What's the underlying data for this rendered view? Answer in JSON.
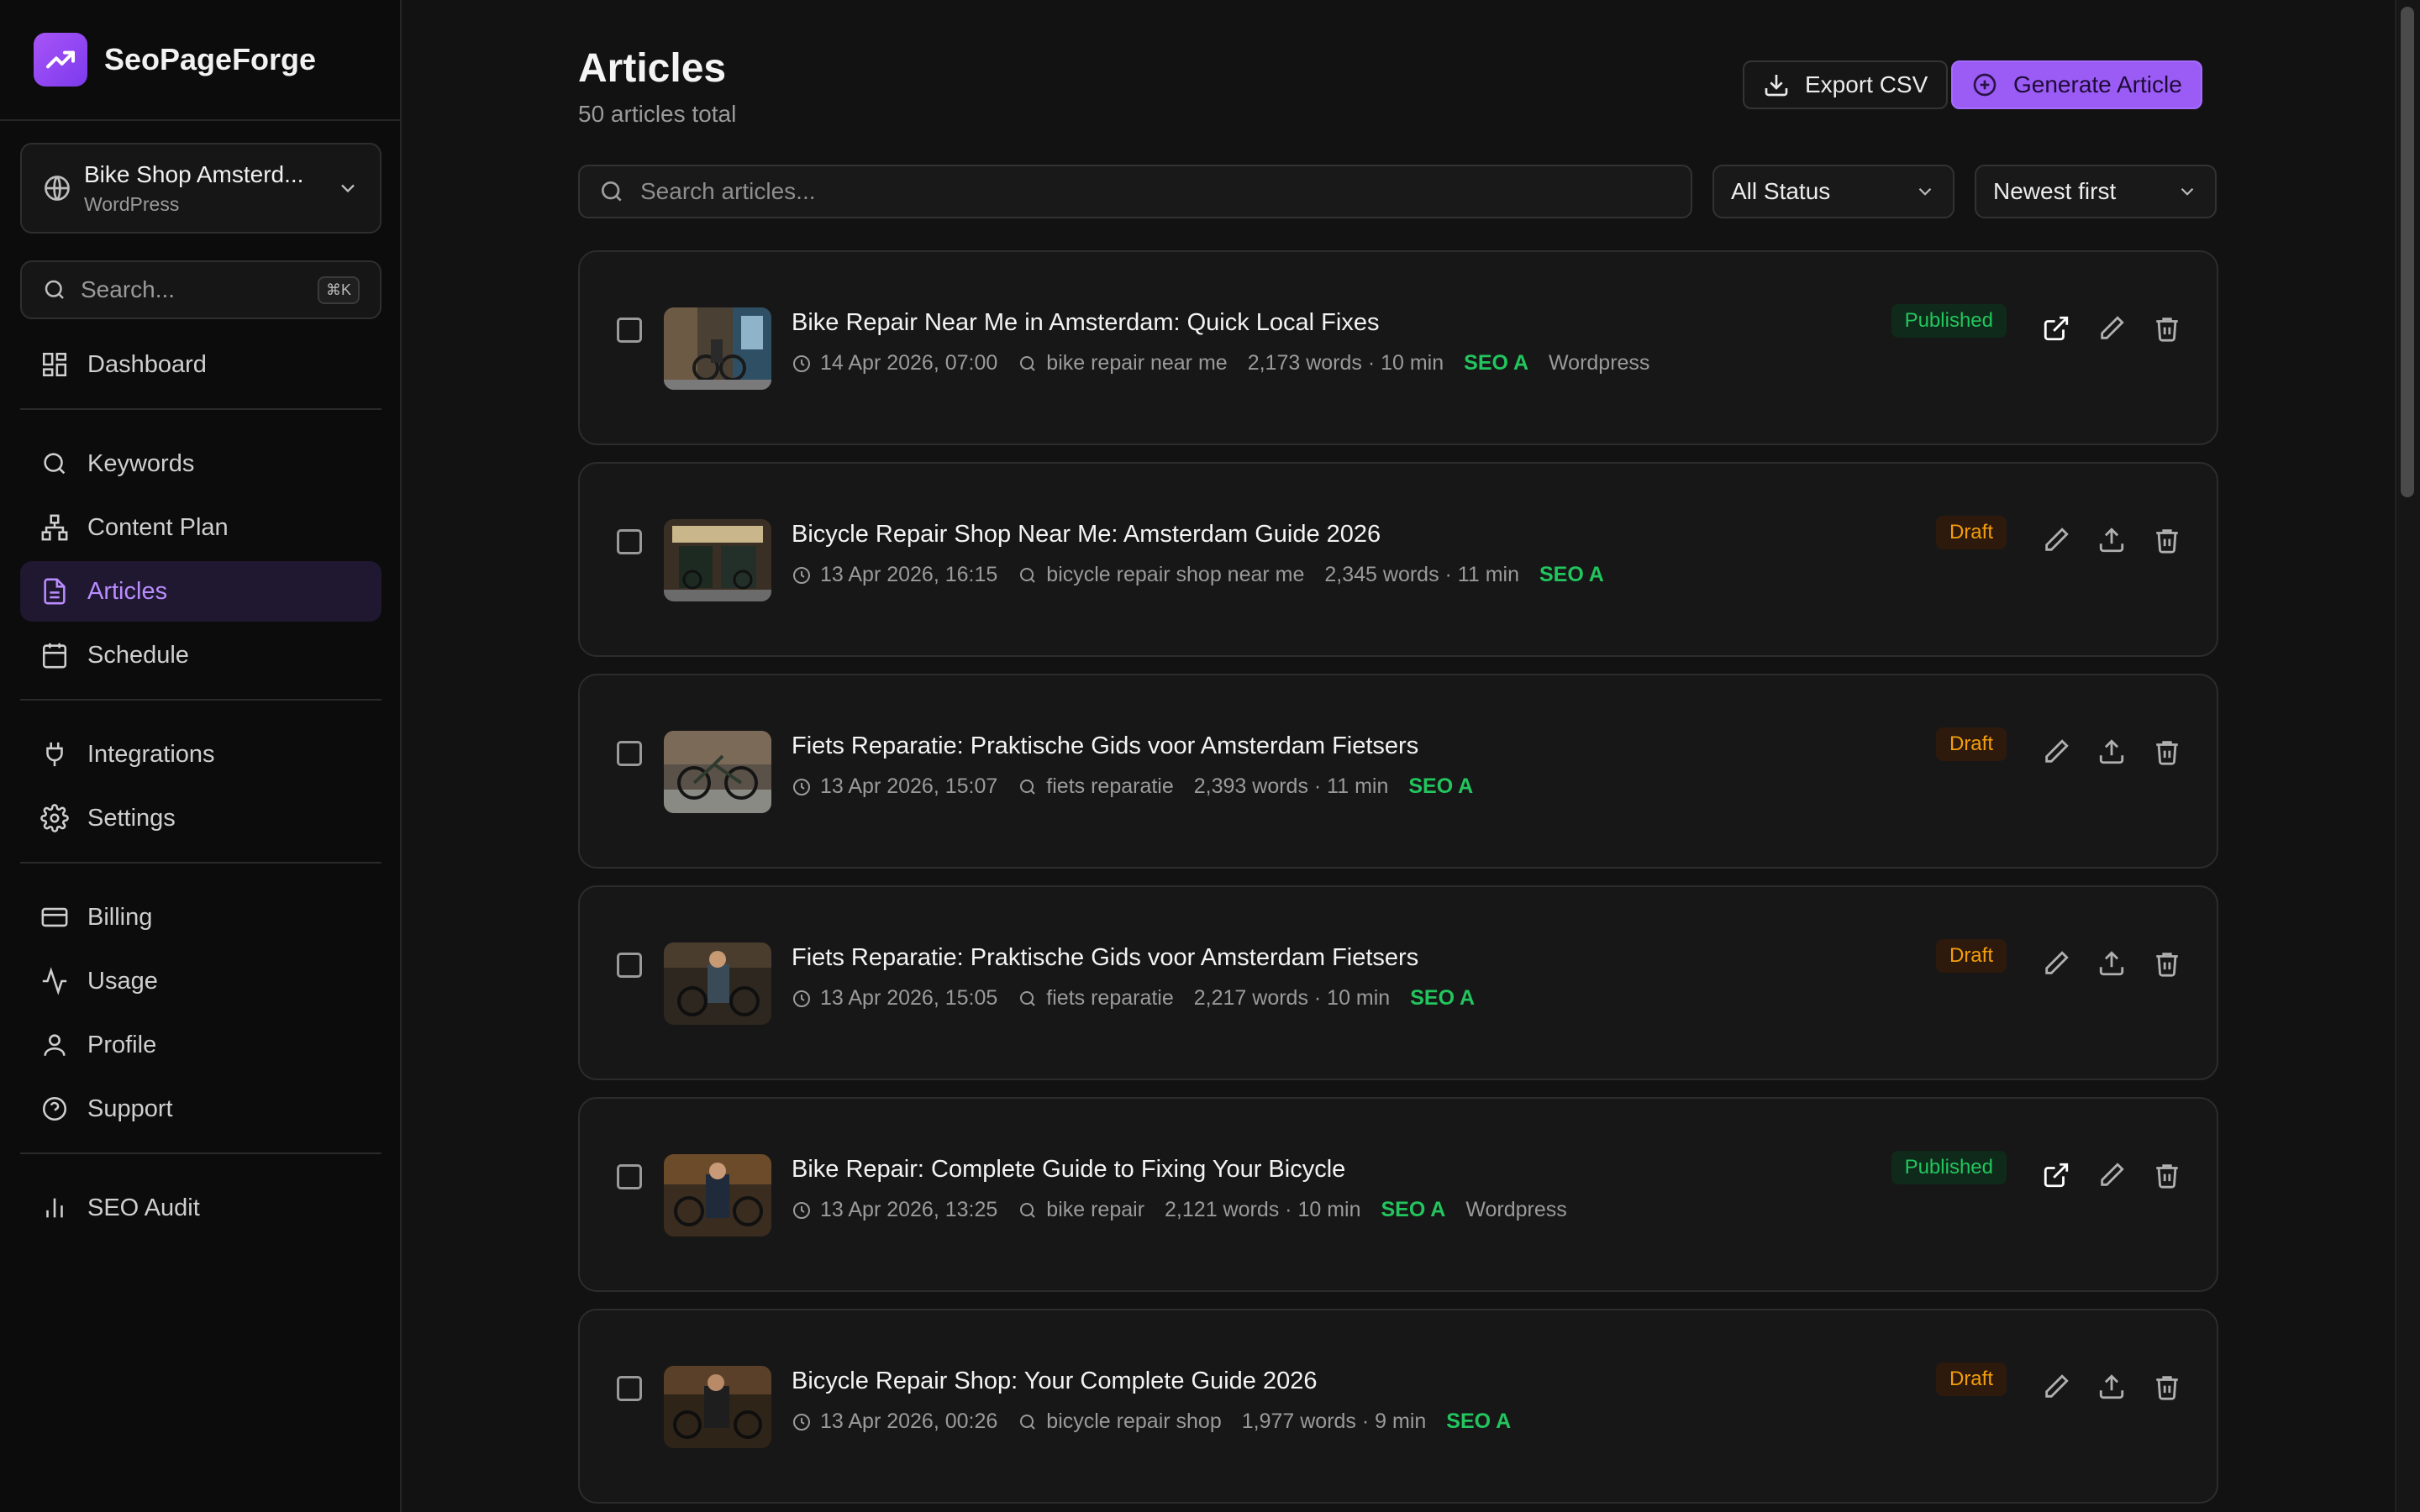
{
  "app": {
    "name": "SeoPageForge"
  },
  "site": {
    "name": "Bike Shop Amsterd...",
    "platform": "WordPress"
  },
  "sidebar": {
    "search_placeholder": "Search...",
    "search_shortcut": "⌘K",
    "groups": [
      [
        {
          "label": "Dashboard",
          "icon": "dashboard-icon"
        }
      ],
      [
        {
          "label": "Keywords",
          "icon": "search-icon"
        },
        {
          "label": "Content Plan",
          "icon": "sitemap-icon"
        },
        {
          "label": "Articles",
          "icon": "document-icon",
          "active": true
        },
        {
          "label": "Schedule",
          "icon": "calendar-icon"
        }
      ],
      [
        {
          "label": "Integrations",
          "icon": "plug-icon"
        },
        {
          "label": "Settings",
          "icon": "gear-icon"
        }
      ],
      [
        {
          "label": "Billing",
          "icon": "credit-card-icon"
        },
        {
          "label": "Usage",
          "icon": "activity-icon"
        },
        {
          "label": "Profile",
          "icon": "user-icon"
        },
        {
          "label": "Support",
          "icon": "help-circle-icon"
        }
      ],
      [
        {
          "label": "SEO Audit",
          "icon": "bar-chart-icon"
        }
      ]
    ]
  },
  "header": {
    "title": "Articles",
    "subtitle": "50 articles total",
    "export_label": "Export CSV",
    "generate_label": "Generate Article"
  },
  "filters": {
    "search_placeholder": "Search articles...",
    "status": "All Status",
    "sort": "Newest first"
  },
  "articles": [
    {
      "title": "Bike Repair Near Me in Amsterdam: Quick Local Fixes",
      "date": "14 Apr 2026, 07:00",
      "keyword": "bike repair near me",
      "stats": "2,173 words · 10 min",
      "seo": "SEO A",
      "platform": "Wordpress",
      "status": "Published"
    },
    {
      "title": "Bicycle Repair Shop Near Me: Amsterdam Guide 2026",
      "date": "13 Apr 2026, 16:15",
      "keyword": "bicycle repair shop near me",
      "stats": "2,345 words · 11 min",
      "seo": "SEO A",
      "platform": "",
      "status": "Draft"
    },
    {
      "title": "Fiets Reparatie: Praktische Gids voor Amsterdam Fietsers",
      "date": "13 Apr 2026, 15:07",
      "keyword": "fiets reparatie",
      "stats": "2,393 words · 11 min",
      "seo": "SEO A",
      "platform": "",
      "status": "Draft"
    },
    {
      "title": "Fiets Reparatie: Praktische Gids voor Amsterdam Fietsers",
      "date": "13 Apr 2026, 15:05",
      "keyword": "fiets reparatie",
      "stats": "2,217 words · 10 min",
      "seo": "SEO A",
      "platform": "",
      "status": "Draft"
    },
    {
      "title": "Bike Repair: Complete Guide to Fixing Your Bicycle",
      "date": "13 Apr 2026, 13:25",
      "keyword": "bike repair",
      "stats": "2,121 words · 10 min",
      "seo": "SEO A",
      "platform": "Wordpress",
      "status": "Published"
    },
    {
      "title": "Bicycle Repair Shop: Your Complete Guide 2026",
      "date": "13 Apr 2026, 00:26",
      "keyword": "bicycle repair shop",
      "stats": "1,977 words · 9 min",
      "seo": "SEO A",
      "platform": "",
      "status": "Draft"
    }
  ],
  "colors": {
    "accent": "#9b5cf6",
    "published": "#22c55e",
    "draft": "#f59e0b",
    "seo": "#22c55e"
  }
}
